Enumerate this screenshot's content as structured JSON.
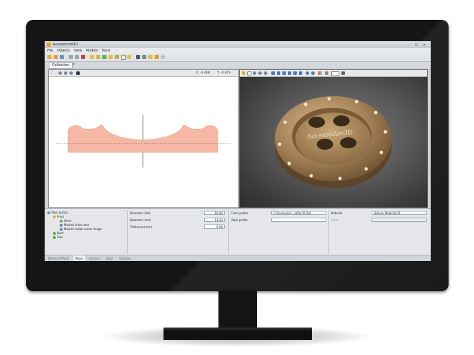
{
  "window": {
    "title": "Accessorize3D",
    "controls": "– ☐ ✕"
  },
  "menu": [
    "File",
    "Objects",
    "View",
    "Models",
    "Tools"
  ],
  "tab": {
    "label": "Collection"
  },
  "left_pane": {
    "coord_x": "X: -4.488",
    "coord_y": "Y: -0.876"
  },
  "button_logo_text": "Accessorize3D",
  "tree": {
    "items": [
      {
        "label": "Main button",
        "icon": "object-icon"
      },
      {
        "label": "Front",
        "icon": "front-icon"
      },
      {
        "label": "Holes",
        "icon": "holes-icon"
      },
      {
        "label": "Marked linear text",
        "icon": "text-icon"
      },
      {
        "label": "Marked radial vector image",
        "icon": "vector-icon"
      },
      {
        "label": "Back",
        "icon": "back-icon"
      },
      {
        "label": "Side",
        "icon": "side-icon"
      }
    ]
  },
  "dimensions": [
    {
      "label": "Diameter (Ltd)",
      "value": "18.00"
    },
    {
      "label": "Diameter (mm)",
      "value": "11.43"
    },
    {
      "label": "Thickness (mm)",
      "value": "2.00"
    }
  ],
  "profiles": {
    "front_label": "Front profile",
    "front_value": "C:\\Accessoriz...rofile 07.dxf",
    "back_label": "Back profile"
  },
  "material": {
    "label": "Material",
    "value": "Texture Material 01",
    "color_label": "Color"
  },
  "bottom_tabs": [
    "Mother-of-Pearl",
    "Wave",
    "Fashion",
    "Shell",
    "Rainbow"
  ],
  "colors": {
    "profile_fill": "#f6b8a4",
    "button_wood": "#a8845a",
    "screen_bezel": "#151515"
  }
}
